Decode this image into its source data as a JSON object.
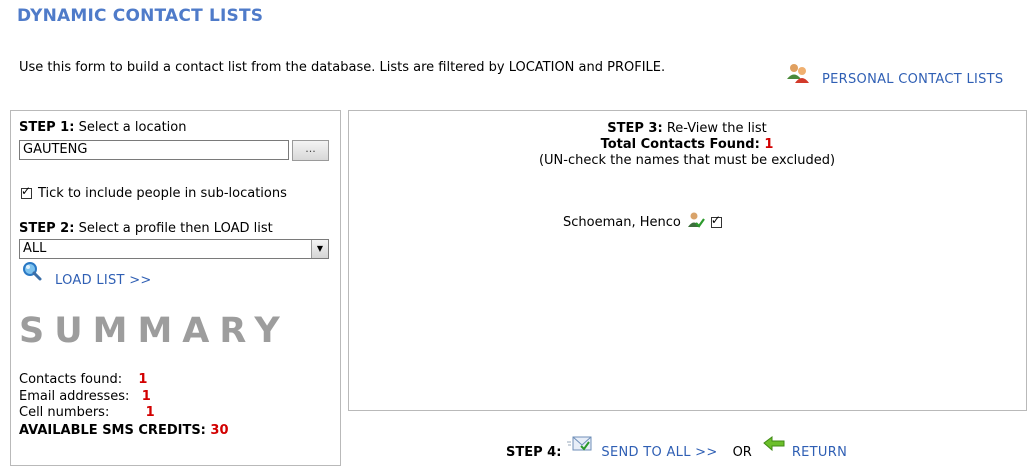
{
  "header": {
    "title": "DYNAMIC CONTACT LISTS",
    "intro": "Use this form to build a contact list from the database. Lists are filtered by LOCATION and PROFILE.",
    "personal_link": "PERSONAL CONTACT LISTS"
  },
  "step1": {
    "label": "STEP 1:",
    "text": "Select a location",
    "location_value": "GAUTENG",
    "browse_label": "...",
    "sublocation_checked": true,
    "sublocation_label": "Tick to include people in sub-locations"
  },
  "step2": {
    "label": "STEP 2:",
    "text": "Select a profile then LOAD list",
    "profile_value": "ALL",
    "load_link": "LOAD LIST >>"
  },
  "summary": {
    "title": "SUMMARY",
    "contacts_label": "Contacts found:",
    "contacts_value": "1",
    "email_label": "Email addresses:",
    "email_value": "1",
    "cell_label": "Cell numbers:",
    "cell_value": "1",
    "credits_label": "AVAILABLE SMS CREDITS:",
    "credits_value": "30"
  },
  "step3": {
    "label": "STEP 3:",
    "text": "Re-View the list",
    "total_label": "Total Contacts Found:",
    "total_value": "1",
    "instruction": "(UN-check the names that must be excluded)",
    "contacts": [
      {
        "name": "Schoeman, Henco",
        "checked": true
      }
    ]
  },
  "step4": {
    "label": "STEP 4:",
    "send_link": "SEND TO ALL >>",
    "or_text": "OR",
    "return_link": "RETURN"
  },
  "colors": {
    "title": "#4f7bc9",
    "link": "#2f5fb4",
    "highlight": "#d20000",
    "summary_gray": "#9d9d9d"
  },
  "icons": [
    "people-icon",
    "magnifier-icon",
    "user-check-icon",
    "mail-send-icon",
    "return-arrow-icon"
  ]
}
